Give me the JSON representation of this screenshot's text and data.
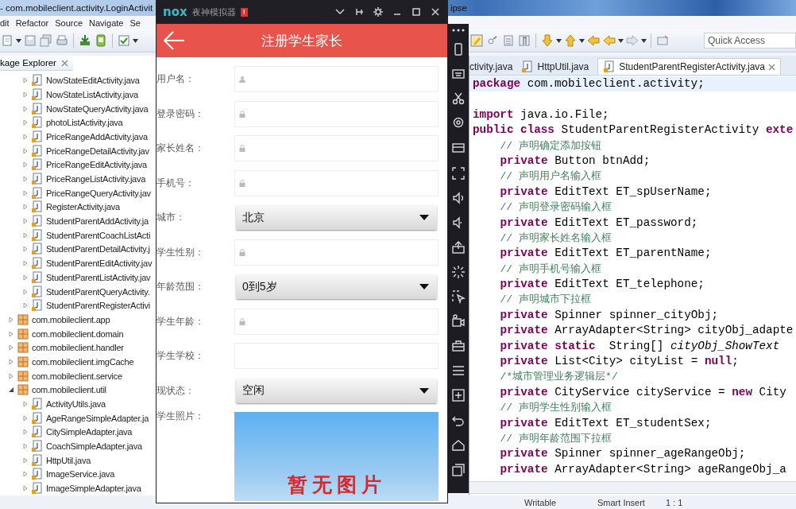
{
  "eclipse": {
    "title": "- com.mobileclient.activity.LoginActivit",
    "title_end": "ipse",
    "menu": [
      "dit",
      "Refactor",
      "Source",
      "Navigate",
      "Se"
    ],
    "quick_access": {
      "placeholder": "Quick Access"
    },
    "package_explorer": {
      "tab": "kage Explorer",
      "continued_items": [
        {
          "label": "NowStateEditActivity.java",
          "expanded": false
        },
        {
          "label": "NowStateListActivity.java",
          "expanded": false
        },
        {
          "label": "NowStateQueryActivity.java",
          "expanded": false
        },
        {
          "label": "photoListActivity.java",
          "expanded": false
        },
        {
          "label": "PriceRangeAddActivity.java",
          "expanded": false
        },
        {
          "label": "PriceRangeDetailActivity.jav",
          "expanded": false
        },
        {
          "label": "PriceRangeEditActivity.java",
          "expanded": false
        },
        {
          "label": "PriceRangeListActivity.java",
          "expanded": false
        },
        {
          "label": "PriceRangeQueryActivity.jav",
          "expanded": false
        },
        {
          "label": "RegisterActivity.java",
          "expanded": false
        },
        {
          "label": "StudentParentAddActivity.ja",
          "expanded": false
        },
        {
          "label": "StudentParentCoachListActi",
          "expanded": false
        },
        {
          "label": "StudentParentDetailActivity.j",
          "expanded": false
        },
        {
          "label": "StudentParentEditActivity.jav",
          "expanded": false
        },
        {
          "label": "StudentParentListActivity.jav",
          "expanded": false
        },
        {
          "label": "StudentParentQueryActivity.",
          "expanded": false
        },
        {
          "label": "StudentParentRegisterActivi",
          "expanded": false
        }
      ],
      "packages": [
        {
          "label": "com.mobileclient.app",
          "expanded": false
        },
        {
          "label": "com.mobileclient.domain",
          "expanded": false
        },
        {
          "label": "com.mobileclient.handler",
          "expanded": false
        },
        {
          "label": "com.mobileclient.imgCache",
          "expanded": false
        },
        {
          "label": "com.mobileclient.service",
          "expanded": false
        },
        {
          "label": "com.mobileclient.util",
          "expanded": true,
          "children": [
            {
              "label": "ActivityUtils.java",
              "expanded": false
            },
            {
              "label": "AgeRangeSimpleAdapter.ja",
              "expanded": false
            },
            {
              "label": "CitySimpleAdapter.java",
              "expanded": false
            },
            {
              "label": "CoachSimpleAdapter.java",
              "expanded": false
            },
            {
              "label": "HttpUtil.java",
              "expanded": false
            },
            {
              "label": "ImageService.java",
              "expanded": false
            },
            {
              "label": "ImageSimpleAdapter.java",
              "expanded": false
            }
          ]
        }
      ]
    },
    "editor": {
      "tabs": [
        {
          "label": "ctivity.java",
          "selected": false
        },
        {
          "label": "HttpUtil.java",
          "selected": false
        },
        {
          "label": "StudentParentRegisterActivity.java",
          "selected": true
        }
      ],
      "lines": [
        {
          "kind": "code",
          "indented": false,
          "highlighted": true,
          "tokens": [
            {
              "kind": "keyword",
              "text": "package"
            },
            {
              "kind": "plain",
              "text": " com.mobileclient.activity;"
            }
          ]
        },
        {
          "kind": "blank"
        },
        {
          "kind": "code",
          "indented": false,
          "highlighted": false,
          "tokens": [
            {
              "kind": "keyword",
              "text": "import"
            },
            {
              "kind": "plain",
              "text": " java.io.File;"
            }
          ]
        },
        {
          "kind": "code",
          "indented": false,
          "highlighted": false,
          "tokens": [
            {
              "kind": "keyword",
              "text": "public class"
            },
            {
              "kind": "plain",
              "text": " StudentParentRegisterActivity "
            },
            {
              "kind": "keyword",
              "text": "exte"
            }
          ]
        },
        {
          "kind": "code",
          "indented": true,
          "highlighted": false,
          "tokens": [
            {
              "kind": "comment",
              "text": "// 声明确定添加按钮"
            }
          ]
        },
        {
          "kind": "code",
          "indented": true,
          "highlighted": false,
          "tokens": [
            {
              "kind": "keyword",
              "text": "private"
            },
            {
              "kind": "plain",
              "text": " Button btnAdd;"
            }
          ]
        },
        {
          "kind": "code",
          "indented": true,
          "highlighted": false,
          "tokens": [
            {
              "kind": "comment",
              "text": "// 声明用户名输入框"
            }
          ]
        },
        {
          "kind": "code",
          "indented": true,
          "highlighted": false,
          "tokens": [
            {
              "kind": "keyword",
              "text": "private"
            },
            {
              "kind": "plain",
              "text": " EditText ET_spUserName;"
            }
          ]
        },
        {
          "kind": "code",
          "indented": true,
          "highlighted": false,
          "tokens": [
            {
              "kind": "comment",
              "text": "// 声明登录密码输入框"
            }
          ]
        },
        {
          "kind": "code",
          "indented": true,
          "highlighted": false,
          "tokens": [
            {
              "kind": "keyword",
              "text": "private"
            },
            {
              "kind": "plain",
              "text": " EditText ET_password;"
            }
          ]
        },
        {
          "kind": "code",
          "indented": true,
          "highlighted": false,
          "tokens": [
            {
              "kind": "comment",
              "text": "// 声明家长姓名输入框"
            }
          ]
        },
        {
          "kind": "code",
          "indented": true,
          "highlighted": false,
          "tokens": [
            {
              "kind": "keyword",
              "text": "private"
            },
            {
              "kind": "plain",
              "text": " EditText ET_parentName;"
            }
          ]
        },
        {
          "kind": "code",
          "indented": true,
          "highlighted": false,
          "tokens": [
            {
              "kind": "comment",
              "text": "// 声明手机号输入框"
            }
          ]
        },
        {
          "kind": "code",
          "indented": true,
          "highlighted": false,
          "tokens": [
            {
              "kind": "keyword",
              "text": "private"
            },
            {
              "kind": "plain",
              "text": " EditText ET_telephone;"
            }
          ]
        },
        {
          "kind": "code",
          "indented": true,
          "highlighted": false,
          "tokens": [
            {
              "kind": "comment",
              "text": "// 声明城市下拉框"
            }
          ]
        },
        {
          "kind": "code",
          "indented": true,
          "highlighted": false,
          "tokens": [
            {
              "kind": "keyword",
              "text": "private"
            },
            {
              "kind": "plain",
              "text": " Spinner spinner_cityObj;"
            }
          ]
        },
        {
          "kind": "code",
          "indented": true,
          "highlighted": false,
          "tokens": [
            {
              "kind": "keyword",
              "text": "private"
            },
            {
              "kind": "plain",
              "text": " ArrayAdapter<String> cityObj_adapte"
            }
          ]
        },
        {
          "kind": "code",
          "indented": true,
          "highlighted": false,
          "tokens": [
            {
              "kind": "keyword",
              "text": "private static"
            },
            {
              "kind": "plain",
              "text": "  String[] "
            },
            {
              "kind": "italic",
              "text": "cityObj_ShowText"
            }
          ]
        },
        {
          "kind": "code",
          "indented": true,
          "highlighted": false,
          "tokens": [
            {
              "kind": "keyword",
              "text": "private"
            },
            {
              "kind": "plain",
              "text": " List<City> cityList = "
            },
            {
              "kind": "keyword",
              "text": "null"
            },
            {
              "kind": "plain",
              "text": ";"
            }
          ]
        },
        {
          "kind": "code",
          "indented": true,
          "highlighted": false,
          "tokens": [
            {
              "kind": "comment",
              "text": "/*城市管理业务逻辑层*/"
            }
          ]
        },
        {
          "kind": "code",
          "indented": true,
          "highlighted": false,
          "tokens": [
            {
              "kind": "keyword",
              "text": "private"
            },
            {
              "kind": "plain",
              "text": " CityService cityService = "
            },
            {
              "kind": "keyword",
              "text": "new"
            },
            {
              "kind": "plain",
              "text": " City"
            }
          ]
        },
        {
          "kind": "code",
          "indented": true,
          "highlighted": false,
          "tokens": [
            {
              "kind": "comment",
              "text": "// 声明学生性别输入框"
            }
          ]
        },
        {
          "kind": "code",
          "indented": true,
          "highlighted": false,
          "tokens": [
            {
              "kind": "keyword",
              "text": "private"
            },
            {
              "kind": "plain",
              "text": " EditText ET_studentSex;"
            }
          ]
        },
        {
          "kind": "code",
          "indented": true,
          "highlighted": false,
          "tokens": [
            {
              "kind": "comment",
              "text": "// 声明年龄范围下拉框"
            }
          ]
        },
        {
          "kind": "code",
          "indented": true,
          "highlighted": false,
          "tokens": [
            {
              "kind": "keyword",
              "text": "private"
            },
            {
              "kind": "plain",
              "text": " Spinner spinner_ageRangeObj;"
            }
          ]
        },
        {
          "kind": "code",
          "indented": true,
          "highlighted": false,
          "tokens": [
            {
              "kind": "keyword",
              "text": "private"
            },
            {
              "kind": "plain",
              "text": " ArrayAdapter<String> ageRangeObj_a"
            }
          ]
        }
      ]
    },
    "status_bar": [
      "Writable",
      "Smart Insert",
      "1 : 1"
    ]
  },
  "emulator": {
    "brand": "nox",
    "title": "夜神模拟器",
    "badge": "!",
    "app_title": "注册学生家长",
    "form": [
      {
        "label": "用户名：",
        "kind": "text",
        "hint": {
          "kind": "person"
        }
      },
      {
        "label": "登录密码：",
        "kind": "text",
        "hint": {
          "kind": "lock"
        }
      },
      {
        "label": "家长姓名：",
        "kind": "text",
        "hint": {
          "kind": "lock"
        }
      },
      {
        "label": "手机号：",
        "kind": "text",
        "hint": {
          "kind": "lock"
        }
      },
      {
        "label": "城市：",
        "kind": "select",
        "value": "北京"
      },
      {
        "label": "学生性别：",
        "kind": "text",
        "hint": {
          "kind": "lock"
        }
      },
      {
        "label": "年龄范围：",
        "kind": "select",
        "value": "0到5岁"
      },
      {
        "label": "学生年龄：",
        "kind": "text",
        "hint": {
          "kind": "lock"
        }
      },
      {
        "label": "学生学校：",
        "kind": "text"
      },
      {
        "label": "现状态：",
        "kind": "select",
        "value": "空闲"
      },
      {
        "label": "学生照片：",
        "kind": "photo",
        "text": "暂无图片"
      }
    ]
  }
}
